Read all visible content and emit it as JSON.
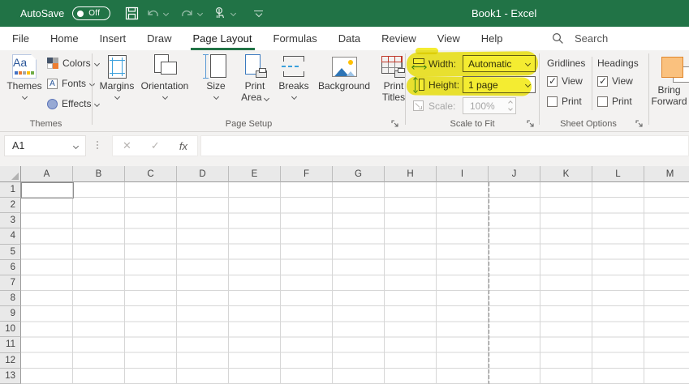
{
  "colors": {
    "titlebar_green": "#217346",
    "tab_underline_green": "#217346",
    "highlight_yellow": "#f3e90c",
    "ribbon_background": "#f3f2f1"
  },
  "titlebar": {
    "autosave_label": "AutoSave",
    "autosave_state": "Off",
    "title": "Book1 - Excel"
  },
  "tabs": {
    "items": [
      {
        "label": "File"
      },
      {
        "label": "Home"
      },
      {
        "label": "Insert"
      },
      {
        "label": "Draw"
      },
      {
        "label": "Page Layout",
        "active": true
      },
      {
        "label": "Formulas"
      },
      {
        "label": "Data"
      },
      {
        "label": "Review"
      },
      {
        "label": "View"
      },
      {
        "label": "Help"
      }
    ],
    "search_label": "Search"
  },
  "ribbon": {
    "themes_group": {
      "caption": "Themes",
      "themes_button": "Themes",
      "colors_button": "Colors",
      "fonts_button": "Fonts",
      "effects_button": "Effects"
    },
    "page_setup_group": {
      "caption": "Page Setup",
      "margins": "Margins",
      "orientation": "Orientation",
      "size": "Size",
      "print_area_line1": "Print",
      "print_area_line2": "Area",
      "breaks": "Breaks",
      "background": "Background",
      "print_titles_line1": "Print",
      "print_titles_line2": "Titles"
    },
    "scale_group": {
      "caption": "Scale to Fit",
      "width_label": "Width:",
      "width_value": "Automatic",
      "height_label": "Height:",
      "height_value": "1 page",
      "scale_label": "Scale:",
      "scale_value": "100%"
    },
    "sheet_options_group": {
      "caption": "Sheet Options",
      "col1_header": "Gridlines",
      "col2_header": "Headings",
      "view_label": "View",
      "print_label": "Print",
      "gridlines_view_checked": true,
      "gridlines_print_checked": false,
      "headings_view_checked": true,
      "headings_print_checked": false
    },
    "arrange_group": {
      "bring_forward_line1": "Bring",
      "bring_forward_line2": "Forward"
    }
  },
  "formula_bar": {
    "name_box_value": "A1",
    "fx_label": "fx"
  },
  "grid": {
    "columns": [
      "A",
      "B",
      "C",
      "D",
      "E",
      "F",
      "G",
      "H",
      "I",
      "J",
      "K",
      "L",
      "M"
    ],
    "visible_rows": 13,
    "selected_cell": "A1",
    "page_break_after_column": "I"
  }
}
